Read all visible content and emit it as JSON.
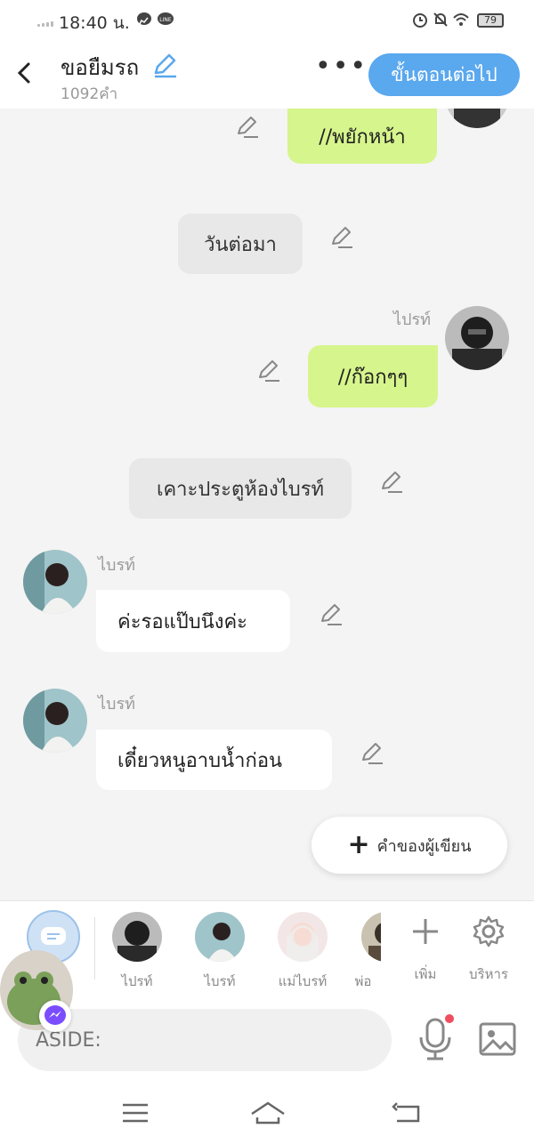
{
  "status_bar": {
    "time": "18:40 น.",
    "battery": "79"
  },
  "header": {
    "title": "ขอยืมรถ",
    "word_count": "1092คำ",
    "more_label": "•••",
    "next_button": "ขั้นตอนต่อไป"
  },
  "messages": [
    {
      "type": "green",
      "sender": "",
      "text": "//พยักหน้า"
    },
    {
      "type": "narration",
      "text": "วันต่อมา"
    },
    {
      "type": "green",
      "sender": "ไปรท์",
      "text": "//ก๊อกๆๆ"
    },
    {
      "type": "narration",
      "text": "เคาะประตูห้องไบรท์"
    },
    {
      "type": "white",
      "sender": "ไบรท์",
      "text": "ค่ะรอแป๊บนึงค่ะ"
    },
    {
      "type": "white",
      "sender": "ไบรท์",
      "text": "เดี๋ยวหนูอาบน้ำก่อน"
    }
  ],
  "add_words_button": "คำของผู้เขียน",
  "characters": [
    {
      "name": "ไปรท์"
    },
    {
      "name": "ไบรท์"
    },
    {
      "name": "แม่ไบรท์"
    },
    {
      "name": "พ่อ"
    }
  ],
  "tools": {
    "add_label": "เพิ่ม",
    "manage_label": "บริหาร"
  },
  "input": {
    "placeholder": "ASIDE:"
  },
  "colors": {
    "accent": "#5aa8ee",
    "green_bubble": "#d6f58c",
    "notification_dot": "#f04e5e"
  }
}
